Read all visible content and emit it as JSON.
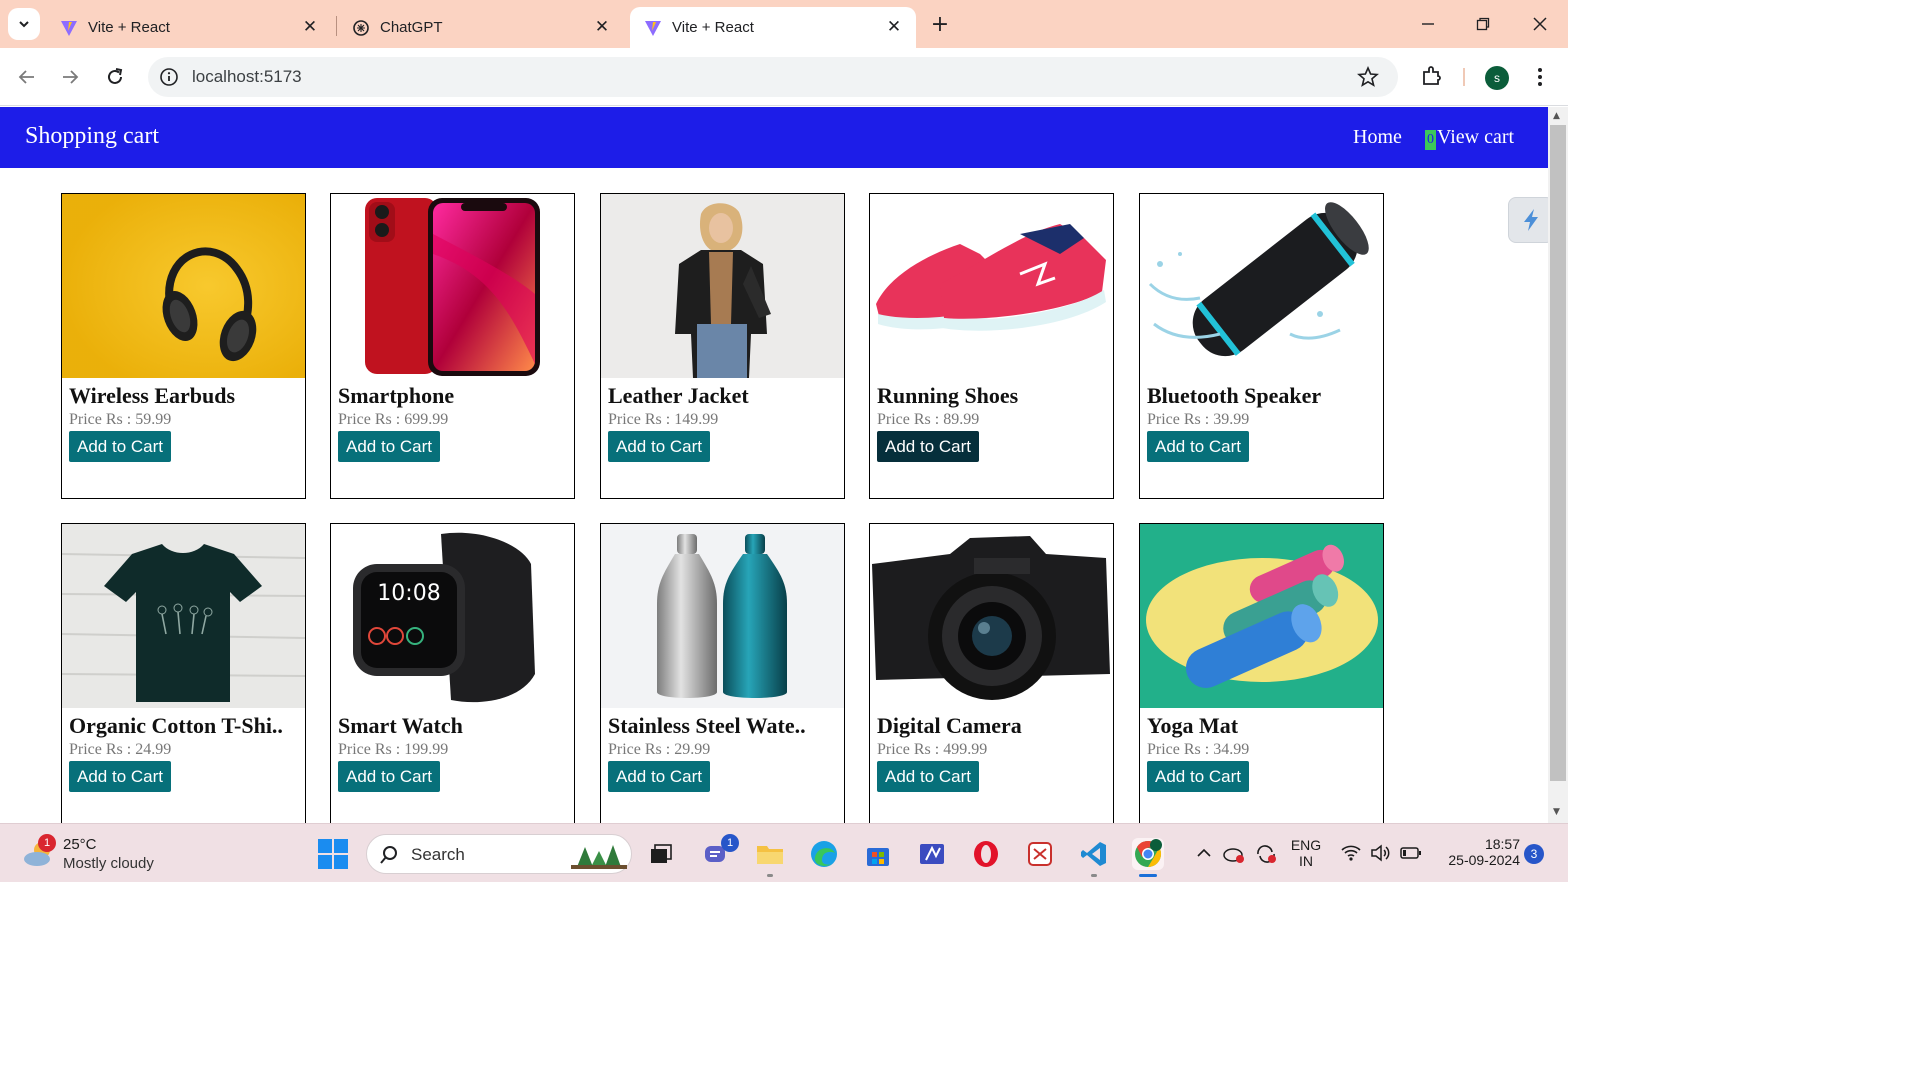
{
  "browser": {
    "tabs": [
      {
        "title": "Vite + React",
        "icon": "vite-icon",
        "active": false
      },
      {
        "title": "ChatGPT",
        "icon": "chatgpt-icon",
        "active": false
      },
      {
        "title": "Vite + React",
        "icon": "vite-icon",
        "active": true
      }
    ],
    "new_tab_label": "+",
    "url": "localhost:5173",
    "profile_initial": "s"
  },
  "page": {
    "brand": "Shopping cart",
    "nav": {
      "home": "Home",
      "cart_count": "0",
      "view_cart": "View cart"
    },
    "price_prefix": "Price Rs : ",
    "products": [
      {
        "name": "Wireless Earbuds",
        "price": "Price Rs : 59.99",
        "button": "Add to Cart"
      },
      {
        "name": "Smartphone",
        "price": "Price Rs : 699.99",
        "button": "Add to Cart"
      },
      {
        "name": "Leather Jacket",
        "price": "Price Rs : 149.99",
        "button": "Add to Cart"
      },
      {
        "name": "Running Shoes",
        "price": "Price Rs : 89.99",
        "button": "Add to Cart"
      },
      {
        "name": "Bluetooth Speaker",
        "price": "Price Rs : 39.99",
        "button": "Add to Cart"
      },
      {
        "name": "Organic Cotton T-Shi..",
        "price": "Price Rs : 24.99",
        "button": "Add to Cart"
      },
      {
        "name": "Smart Watch",
        "price": "Price Rs : 199.99",
        "button": "Add to Cart"
      },
      {
        "name": "Stainless Steel Wate..",
        "price": "Price Rs : 29.99",
        "button": "Add to Cart"
      },
      {
        "name": "Digital Camera",
        "price": "Price Rs : 499.99",
        "button": "Add to Cart"
      },
      {
        "name": "Yoga Mat",
        "price": "Price Rs : 34.99",
        "button": "Add to Cart"
      }
    ],
    "watch_time": "10:08"
  },
  "taskbar": {
    "weather_badge": "1",
    "weather_temp": "25°C",
    "weather_desc": "Mostly cloudy",
    "search_label": "Search",
    "teams_badge": "1",
    "lang_top": "ENG",
    "lang_bottom": "IN",
    "time": "18:57",
    "date": "25-09-2024",
    "notification_count": "3"
  },
  "colors": {
    "navbar": "#1d1de8",
    "button": "#07707a",
    "button_hover": "#062f3b",
    "tab_strip": "#fbd3c2"
  }
}
